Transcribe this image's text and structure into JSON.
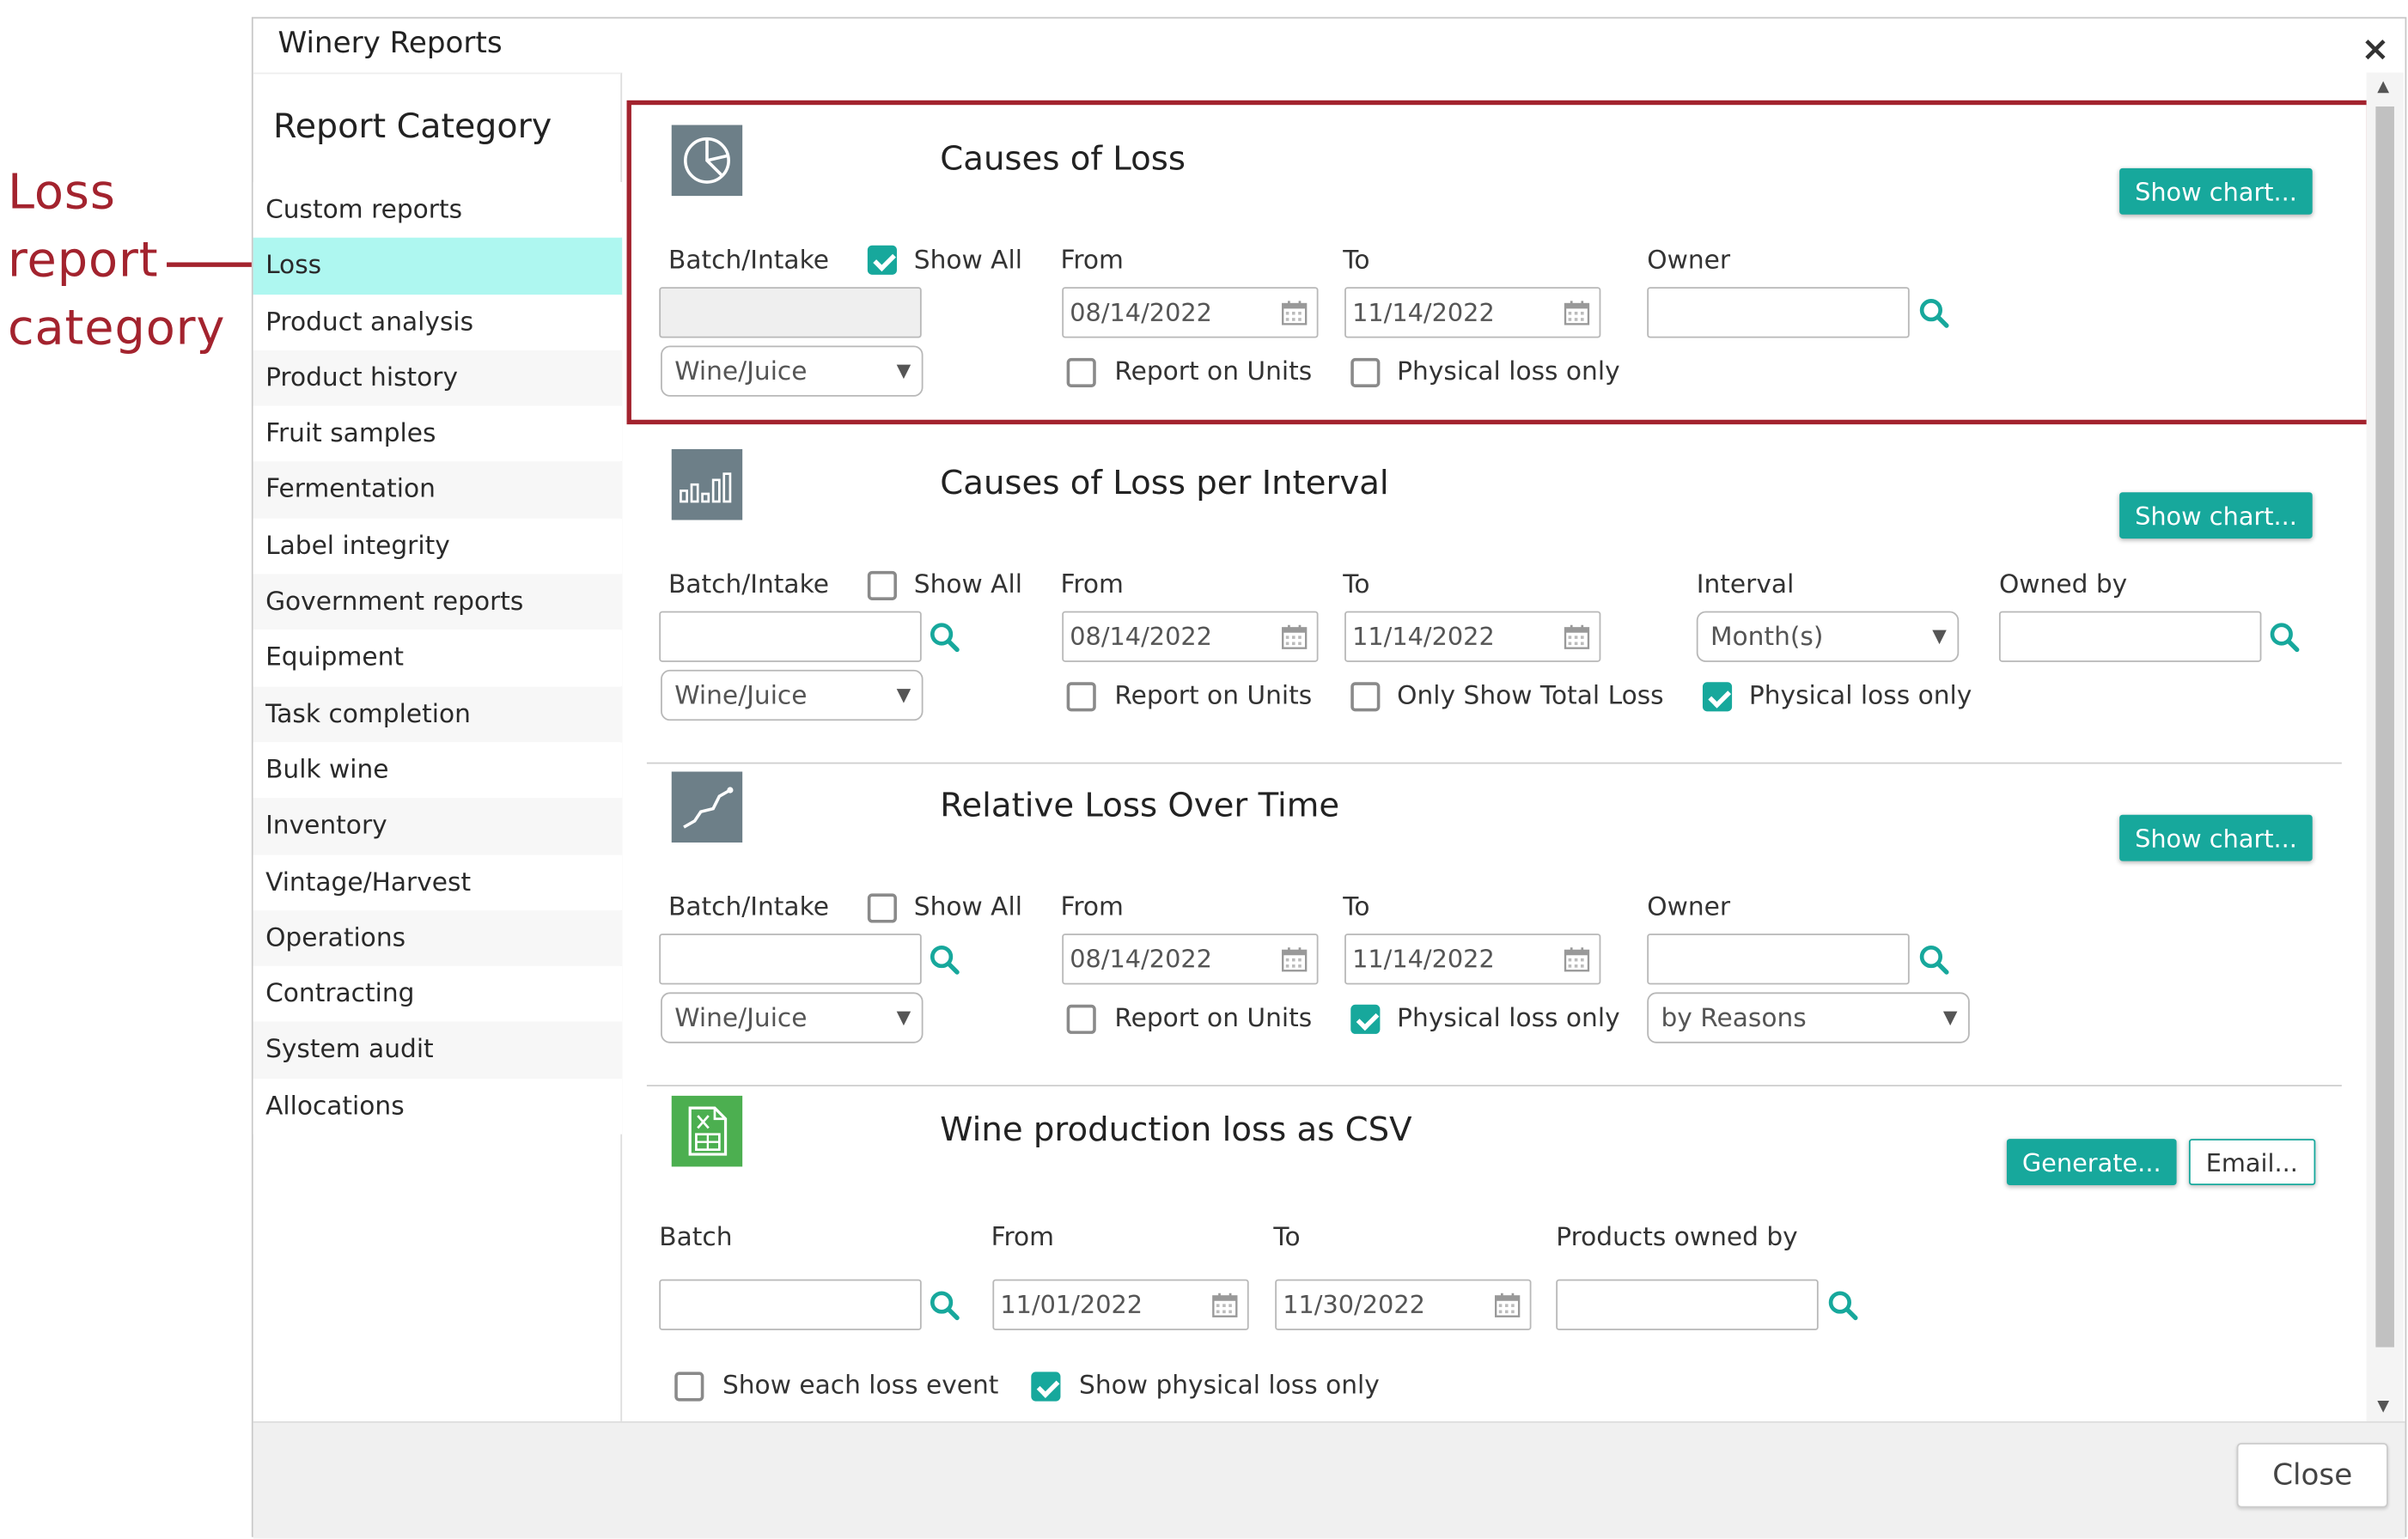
{
  "annotation": {
    "text_lines": [
      "Loss",
      "report",
      "category"
    ],
    "color": "#a3232e"
  },
  "window": {
    "title": "Winery Reports",
    "close_icon": "×"
  },
  "sidebar": {
    "heading": "Report Category",
    "items": [
      {
        "label": "Custom reports"
      },
      {
        "label": "Loss",
        "active": true
      },
      {
        "label": "Product analysis"
      },
      {
        "label": "Product history"
      },
      {
        "label": "Fruit samples"
      },
      {
        "label": "Fermentation"
      },
      {
        "label": "Label integrity"
      },
      {
        "label": "Government reports"
      },
      {
        "label": "Equipment"
      },
      {
        "label": "Task completion"
      },
      {
        "label": "Bulk wine"
      },
      {
        "label": "Inventory"
      },
      {
        "label": "Vintage/Harvest"
      },
      {
        "label": "Operations"
      },
      {
        "label": "Contracting"
      },
      {
        "label": "System audit"
      },
      {
        "label": "Allocations"
      }
    ]
  },
  "reports": {
    "causes_of_loss": {
      "title": "Causes of Loss",
      "icon": "pie-chart-icon",
      "button": "Show chart...",
      "batch_label": "Batch/Intake",
      "show_all_label": "Show All",
      "show_all_checked": true,
      "batch_value": "",
      "type_select": "Wine/Juice",
      "from_label": "From",
      "from_value": "08/14/2022",
      "to_label": "To",
      "to_value": "11/14/2022",
      "owner_label": "Owner",
      "owner_value": "",
      "report_units_label": "Report on Units",
      "report_units_checked": false,
      "physical_label": "Physical loss only",
      "physical_checked": false
    },
    "per_interval": {
      "title": "Causes of Loss per Interval",
      "icon": "bar-chart-icon",
      "button": "Show chart...",
      "batch_label": "Batch/Intake",
      "show_all_label": "Show All",
      "show_all_checked": false,
      "batch_value": "",
      "type_select": "Wine/Juice",
      "from_label": "From",
      "from_value": "08/14/2022",
      "to_label": "To",
      "to_value": "11/14/2022",
      "interval_label": "Interval",
      "interval_select": "Month(s)",
      "owned_by_label": "Owned by",
      "owned_by_value": "",
      "report_units_label": "Report on Units",
      "report_units_checked": false,
      "total_loss_label": "Only Show Total Loss",
      "total_loss_checked": false,
      "physical_label": "Physical loss only",
      "physical_checked": true
    },
    "relative_loss": {
      "title": "Relative Loss Over Time",
      "icon": "line-chart-icon",
      "button": "Show chart...",
      "batch_label": "Batch/Intake",
      "show_all_label": "Show All",
      "show_all_checked": false,
      "batch_value": "",
      "type_select": "Wine/Juice",
      "from_label": "From",
      "from_value": "08/14/2022",
      "to_label": "To",
      "to_value": "11/14/2022",
      "owner_label": "Owner",
      "owner_value": "",
      "report_units_label": "Report on Units",
      "report_units_checked": false,
      "physical_label": "Physical loss only",
      "physical_checked": true,
      "group_select": "by Reasons"
    },
    "csv": {
      "title": "Wine production loss as CSV",
      "icon": "spreadsheet-icon",
      "generate_button": "Generate...",
      "email_button": "Email...",
      "batch_label": "Batch",
      "batch_value": "",
      "from_label": "From",
      "from_value": "11/01/2022",
      "to_label": "To",
      "to_value": "11/30/2022",
      "products_owned_label": "Products owned by",
      "products_owned_value": "",
      "each_event_label": "Show each loss event",
      "each_event_checked": false,
      "physical_label": "Show physical loss only",
      "physical_checked": true
    }
  },
  "footer": {
    "close_button": "Close"
  },
  "colors": {
    "accent": "#17a89c",
    "active_row": "#aef7f0",
    "highlight": "#a3232e",
    "icon_gray": "#6d7f88",
    "icon_green": "#4caf50"
  }
}
